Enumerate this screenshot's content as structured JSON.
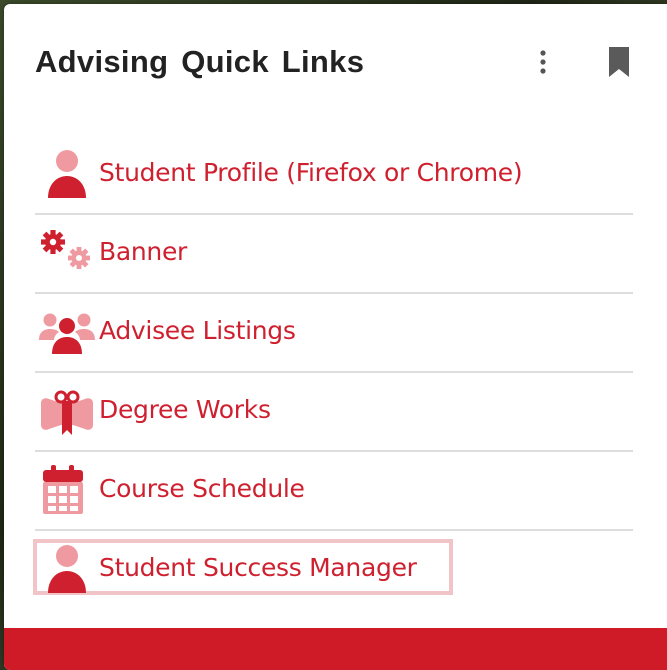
{
  "card": {
    "title": "Advising Quick Links",
    "menu_icon": "more-vertical-icon",
    "bookmark_icon": "bookmark-icon"
  },
  "links": [
    {
      "label": "Student Profile (Firefox or Chrome)",
      "icon": "user-icon"
    },
    {
      "label": "Banner",
      "icon": "gears-icon"
    },
    {
      "label": "Advisee Listings",
      "icon": "users-icon"
    },
    {
      "label": "Degree Works",
      "icon": "diploma-icon"
    },
    {
      "label": "Course Schedule",
      "icon": "calendar-icon"
    },
    {
      "label": "Student Success Manager",
      "icon": "user-icon"
    }
  ],
  "colors": {
    "accent": "#cf202f",
    "accent_light": "#ef9aa0",
    "footer": "#cf1b28",
    "divider": "#dddddd",
    "title": "#222222"
  }
}
